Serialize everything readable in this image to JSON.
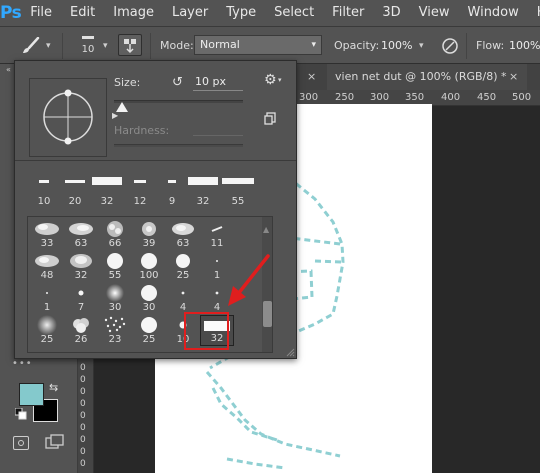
{
  "menubar": {
    "logo": "Ps",
    "items": [
      "File",
      "Edit",
      "Image",
      "Layer",
      "Type",
      "Select",
      "Filter",
      "3D",
      "View",
      "Window",
      "Help"
    ]
  },
  "options_bar": {
    "brush_preset_size": "10",
    "mode_label": "Mode:",
    "mode_value": "Normal",
    "opacity_label": "Opacity:",
    "opacity_value": "100%",
    "flow_label": "Flow:",
    "flow_value": "100%"
  },
  "tabs": [
    {
      "title": "vien net dut @ 100% (RGB/8) *",
      "close": "×"
    }
  ],
  "ruler_top": [
    "300",
    "250",
    "300",
    "350",
    "400",
    "450",
    "500"
  ],
  "ruler_left": [
    "0",
    "0",
    "0",
    "0",
    "0",
    "0",
    "0",
    "0",
    "0"
  ],
  "brush_panel": {
    "size_label": "Size:",
    "size_value": "10 px",
    "hardness_label": "Hardness:",
    "recent": [
      "10",
      "20",
      "32",
      "12",
      "9",
      "32",
      "55"
    ],
    "grid": [
      [
        "33",
        "63",
        "66",
        "39",
        "63",
        "11"
      ],
      [
        "48",
        "32",
        "55",
        "100",
        "25",
        "1"
      ],
      [
        "1",
        "7",
        "30",
        "30",
        "4",
        "4"
      ],
      [
        "25",
        "26",
        "23",
        "25",
        "10",
        "32"
      ]
    ],
    "selected_brush": "32"
  },
  "colors": {
    "foreground": "#84c9cc",
    "background": "#000000",
    "annotation": "#e01e1e",
    "dash_stroke": "#8fcfd2",
    "ps_blue": "#31a8ff"
  },
  "icons": {
    "brush_tool": "brush-icon",
    "airbrush": "airbrush-icon",
    "pressure": "pressure-icon",
    "settings": "gear-icon",
    "reset": "reset-icon",
    "new_preset": "new-preset-icon"
  }
}
